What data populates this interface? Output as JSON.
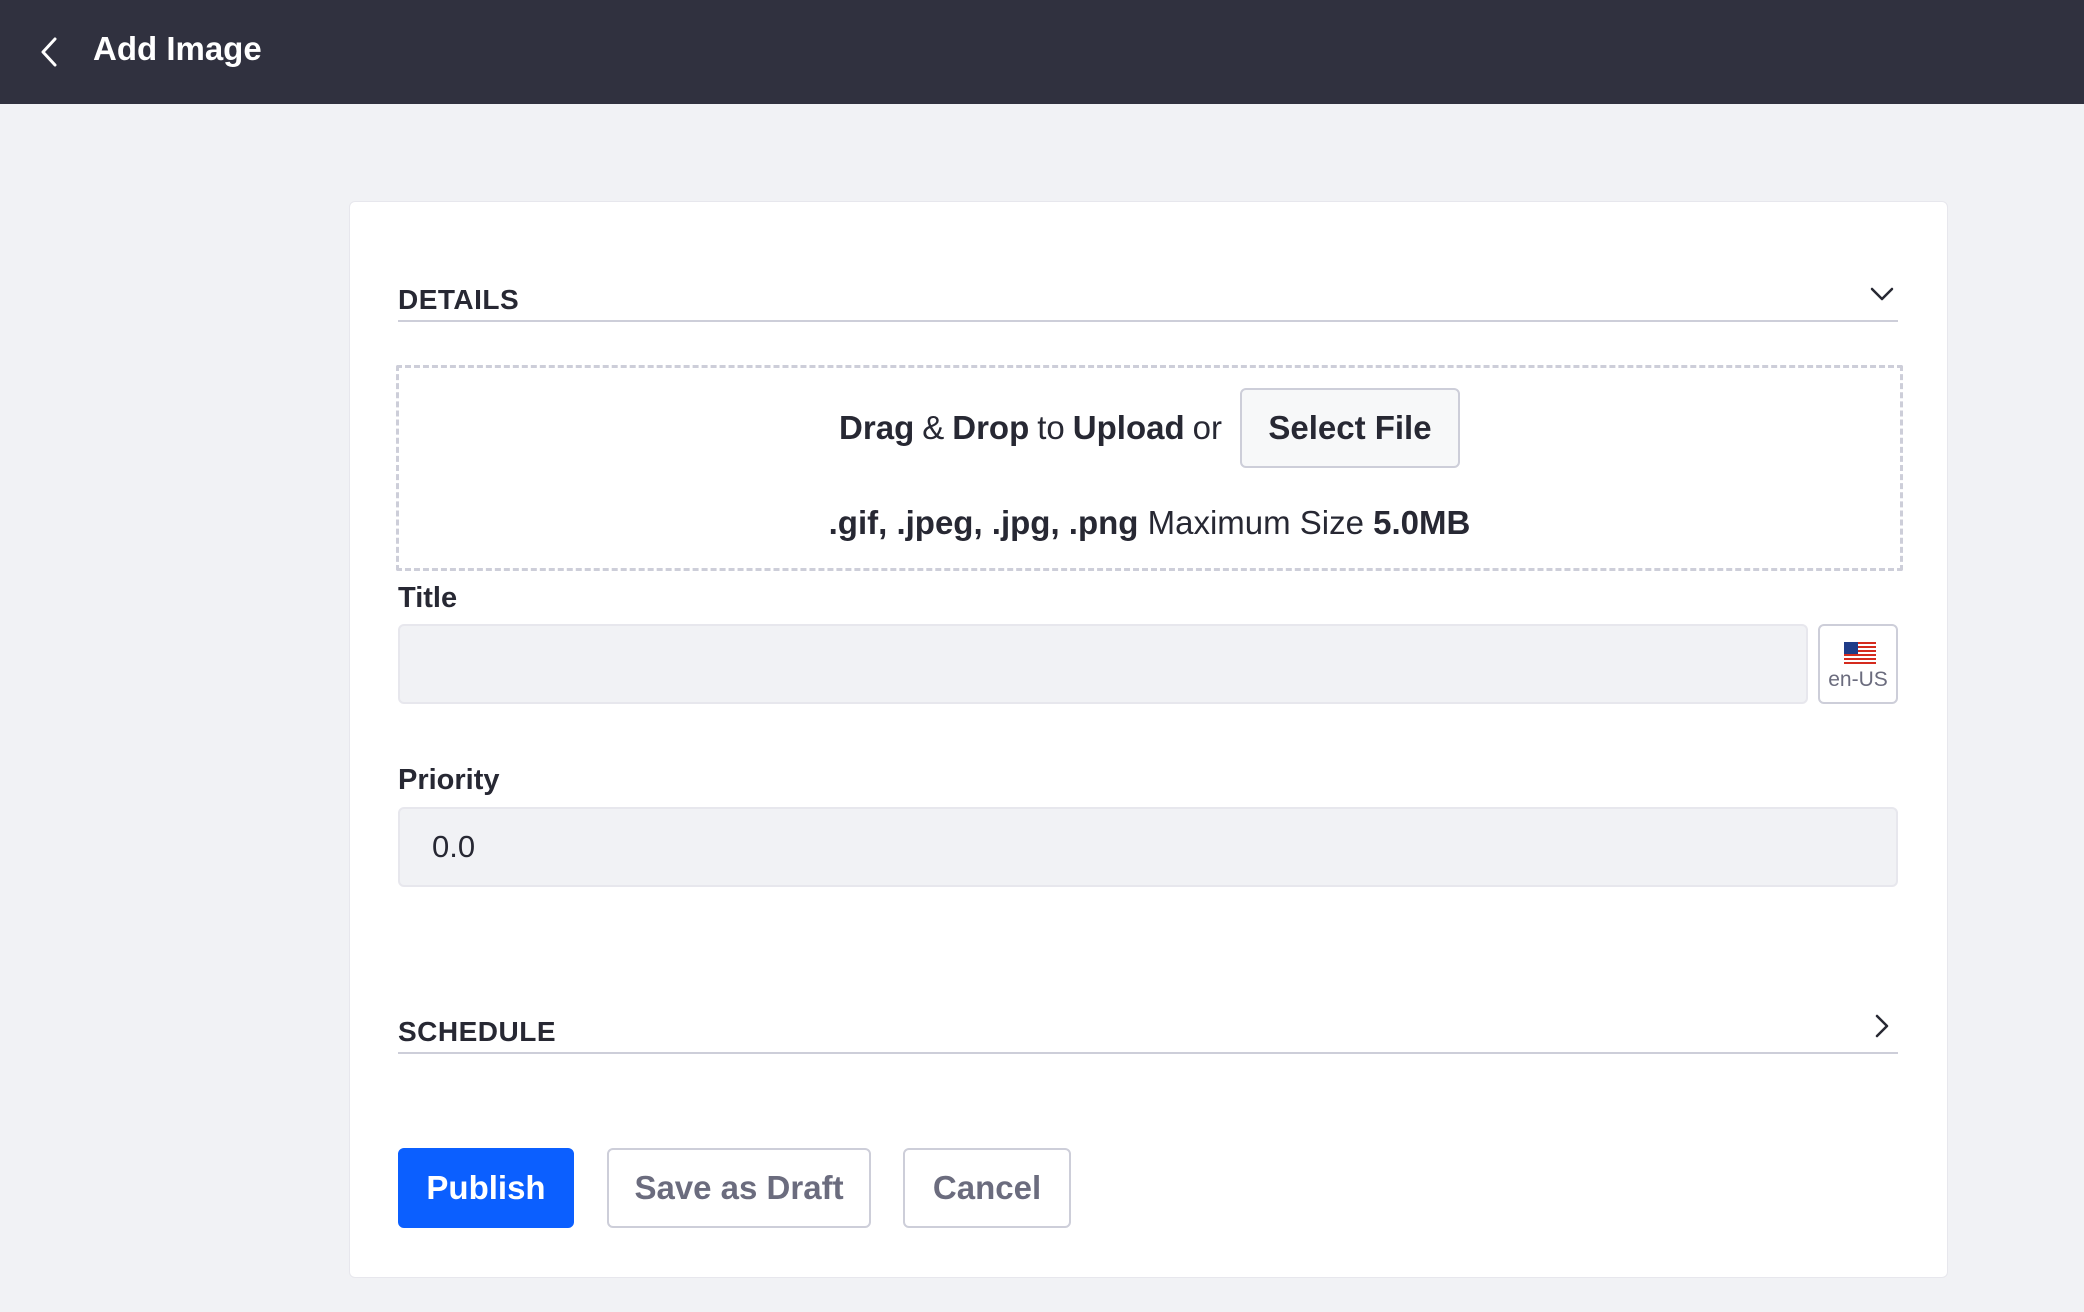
{
  "header": {
    "title": "Add Image",
    "back_icon": "chevron-left-icon"
  },
  "details": {
    "label": "DETAILS",
    "chevron_icon": "chevron-down-icon"
  },
  "dropzone": {
    "drag": "Drag",
    "amp": "&",
    "drop": "Drop",
    "to": "to",
    "upload": "Upload",
    "or": "or",
    "select_file": "Select File",
    "extensions": ".gif, .jpeg, .jpg, .png",
    "max_size_label": "Maximum Size",
    "max_size_value": "5.0MB"
  },
  "title_field": {
    "label": "Title",
    "value": "",
    "language": "en-US",
    "flag_icon": "us-flag-icon"
  },
  "priority_field": {
    "label": "Priority",
    "value": "0.0"
  },
  "schedule": {
    "label": "SCHEDULE",
    "chevron_icon": "chevron-right-icon"
  },
  "actions": {
    "publish": "Publish",
    "save_draft": "Save as Draft",
    "cancel": "Cancel"
  },
  "colors": {
    "topbar": "#30313f",
    "primary": "#0b5fff",
    "background": "#f1f2f5"
  }
}
